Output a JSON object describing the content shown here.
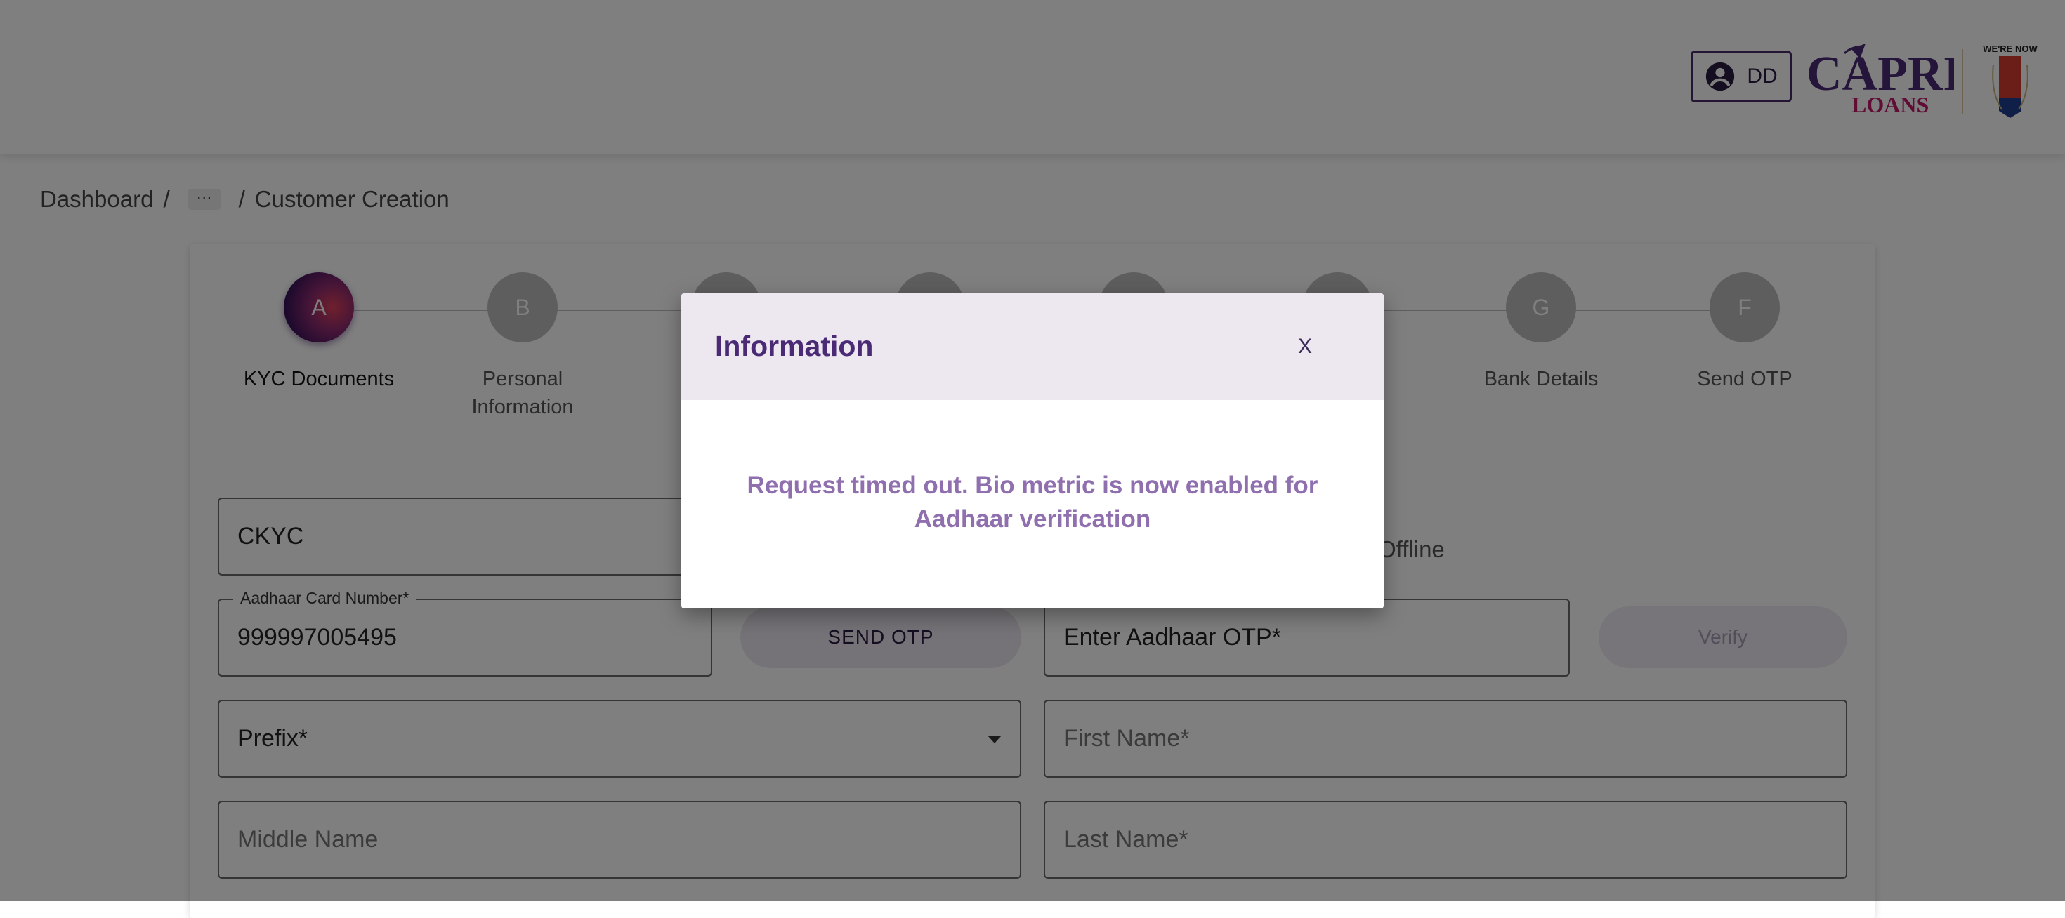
{
  "header": {
    "user_initials": "DD",
    "logo_primary": "CAPRI",
    "logo_secondary": "LOANS",
    "badge_text": "WE'RE NOW"
  },
  "breadcrumb": {
    "items": [
      "Dashboard",
      "Customer Creation"
    ],
    "ellipsis": "···",
    "separator": "/"
  },
  "stepper": {
    "steps": [
      {
        "letter": "A",
        "label": "KYC Documents",
        "active": true
      },
      {
        "letter": "B",
        "label": "Personal Information",
        "active": false
      },
      {
        "letter": "",
        "label": "",
        "active": false
      },
      {
        "letter": "",
        "label": "",
        "active": false
      },
      {
        "letter": "",
        "label": "",
        "active": false
      },
      {
        "letter": "",
        "label": "",
        "active": false
      },
      {
        "letter": "G",
        "label": "Bank Details",
        "active": false
      },
      {
        "letter": "F",
        "label": "Send OTP",
        "active": false
      }
    ]
  },
  "form": {
    "document_type": "CKYC",
    "verification_mode": "Offline",
    "aadhaar": {
      "label": "Aadhaar Card Number*",
      "value": "999997005495"
    },
    "send_otp_label": "SEND OTP",
    "aadhaar_otp_placeholder": "Enter Aadhaar OTP*",
    "verify_label": "Verify",
    "prefix_placeholder": "Prefix*",
    "first_name_placeholder": "First Name*",
    "middle_name_placeholder": "Middle Name",
    "last_name_placeholder": "Last Name*"
  },
  "modal": {
    "title": "Information",
    "close_label": "X",
    "message": "Request timed out. Bio metric is now enabled for Aadhaar verification"
  },
  "colors": {
    "brand_purple": "#4a2a75",
    "message_purple": "#8f6fae",
    "modal_header_bg": "#ede8f0",
    "step_active_dark": "#2a0f55",
    "step_active_red": "#e0405a"
  }
}
